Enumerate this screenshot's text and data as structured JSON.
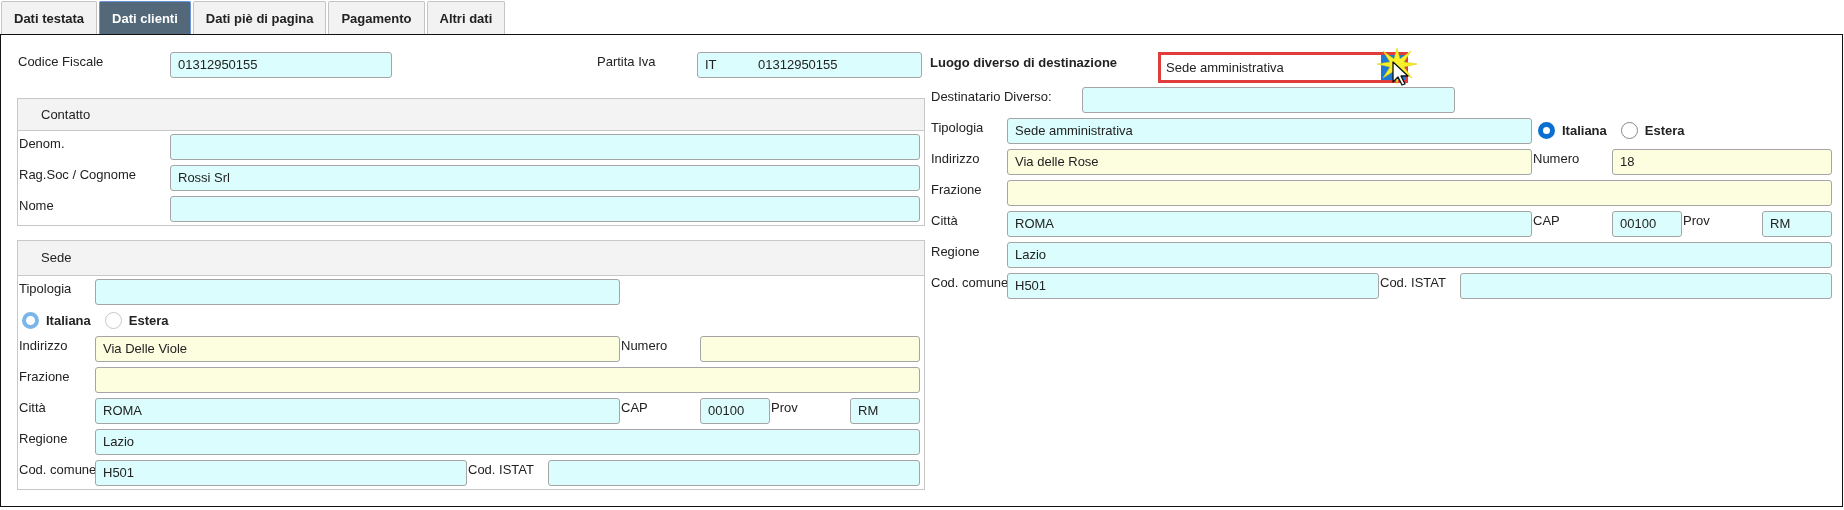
{
  "tabs": [
    {
      "label": "Dati testata",
      "selected": false
    },
    {
      "label": "Dati clienti",
      "selected": true
    },
    {
      "label": "Dati piè di pagina",
      "selected": false
    },
    {
      "label": "Pagamento",
      "selected": false
    },
    {
      "label": "Altri dati",
      "selected": false
    }
  ],
  "codice_fiscale": {
    "label": "Codice Fiscale",
    "value": "01312950155",
    "color": "#dcfdfd"
  },
  "partita_iva": {
    "label": "Partita Iva",
    "prefix": "IT",
    "value": "01312950155",
    "color": "#dcfdfd"
  },
  "contatto": {
    "title": "Contatto",
    "fields": [
      {
        "label": "Denom.",
        "color": "#dcfdfd"
      },
      {
        "label": "Rag.Soc / Cognome",
        "value": "Rossi Srl",
        "color": "#dcfdfd"
      },
      {
        "label": "Nome",
        "color": "#dcfdfd"
      }
    ]
  },
  "sede": {
    "title": "Sede",
    "address": {
      "tipologia": {
        "label": "Tipologia",
        "color": "#dcfdfd"
      },
      "radios": [
        {
          "label": "Italiana",
          "selected": true,
          "disabled": true
        },
        {
          "label": "Estera",
          "selected": false,
          "disabled": true
        }
      ],
      "indirizzo": {
        "label": "Indirizzo",
        "value": "Via Delle Viole",
        "color": "#fdfde0"
      },
      "numero": {
        "label": "Numero",
        "color": "#fdfde0"
      },
      "frazione": {
        "label": "Frazione",
        "color": "#fdfde0"
      },
      "citta": {
        "label": "Città",
        "value": "ROMA",
        "color": "#dcfdfd"
      },
      "cap": {
        "label": "CAP",
        "value": "00100",
        "color": "#dcfdfd"
      },
      "prov": {
        "label": "Prov",
        "value": "RM",
        "color": "#dcfdfd"
      },
      "regione": {
        "label": "Regione",
        "value": "Lazio",
        "color": "#dcfdfd"
      },
      "cod_comune": {
        "label": "Cod. comune",
        "value": "H501",
        "color": "#dcfdfd"
      },
      "cod_istat": {
        "label": "Cod. ISTAT",
        "color": "#dcfdfd"
      }
    }
  },
  "destinazione": {
    "label": "Luogo diverso di destinazione",
    "dropdown": {
      "value": "Sede amministrativa",
      "focused": true
    },
    "destinatario": {
      "label": "Destinatario Diverso:",
      "color": "#dcfdfd"
    },
    "address": {
      "tipologia": {
        "label": "Tipologia",
        "value": "Sede amministrativa",
        "color": "#dcfdfd"
      },
      "radios": [
        {
          "label": "Italiana",
          "selected": true,
          "disabled": false
        },
        {
          "label": "Estera",
          "selected": false,
          "disabled": false
        }
      ],
      "indirizzo": {
        "label": "Indirizzo",
        "value": "Via delle Rose",
        "color": "#fdfde0"
      },
      "numero": {
        "label": "Numero",
        "value": "18",
        "color": "#fdfde0"
      },
      "frazione": {
        "label": "Frazione",
        "color": "#fdfde0"
      },
      "citta": {
        "label": "Città",
        "value": "ROMA",
        "color": "#dcfdfd"
      },
      "cap": {
        "label": "CAP",
        "value": "00100",
        "color": "#dcfdfd"
      },
      "prov": {
        "label": "Prov",
        "value": "RM",
        "color": "#dcfdfd"
      },
      "regione": {
        "label": "Regione",
        "value": "Lazio",
        "color": "#dcfdfd"
      },
      "cod_comune": {
        "label": "Cod. comune",
        "value": "H501",
        "color": "#dcfdfd"
      },
      "cod_istat": {
        "label": "Cod. ISTAT",
        "color": "#dcfdfd"
      }
    }
  }
}
